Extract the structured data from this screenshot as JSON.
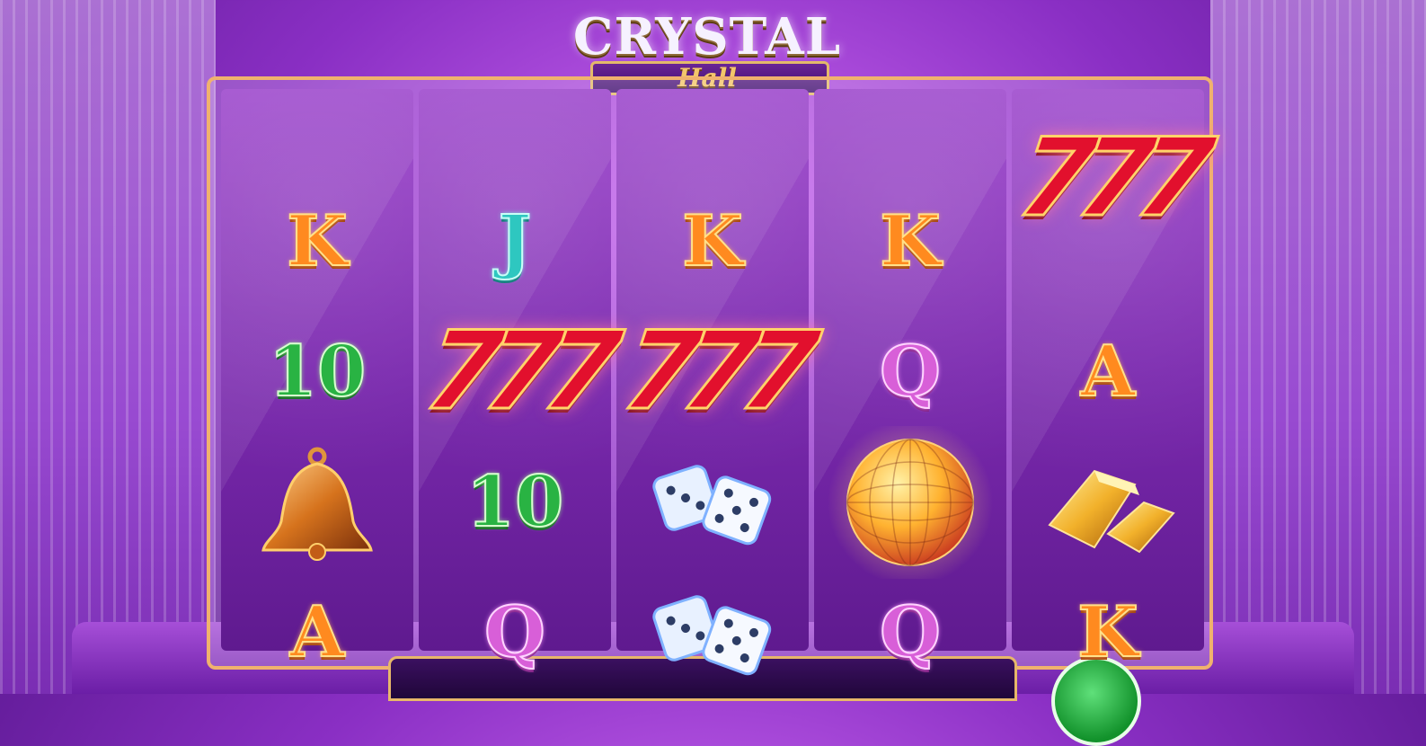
{
  "game": {
    "logo_title": "CRYSTAL",
    "logo_subtitle": "Hall"
  },
  "reels": [
    {
      "symbols": [
        "K",
        "10",
        "bell",
        "A"
      ]
    },
    {
      "symbols": [
        "J",
        "777",
        "10",
        "Q"
      ]
    },
    {
      "symbols": [
        "K",
        "777",
        "dice",
        "dice"
      ]
    },
    {
      "symbols": [
        "K",
        "Q",
        "disco-ball",
        "Q"
      ]
    },
    {
      "symbols": [
        "777",
        "A",
        "gold-bars",
        "K"
      ]
    }
  ],
  "labels": {
    "reel1_row1": "K",
    "reel1_row2": "10",
    "reel1_row4": "A",
    "reel2_row1": "J",
    "reel2_row2": "777",
    "reel2_row3": "10",
    "reel2_row4": "Q",
    "reel3_row1": "K",
    "reel3_row2": "777",
    "reel4_row1": "K",
    "reel4_row2": "Q",
    "reel4_row4": "Q",
    "reel5_row1": "777",
    "reel5_row2": "A",
    "reel5_row4": "K"
  },
  "colors": {
    "frame_gold": "#f0b26e",
    "reel_purple": "#7b2aaf",
    "background": "#8a2fc4",
    "spin_green": "#12922b"
  },
  "icons": [
    "bell-icon",
    "dice-icon",
    "disco-ball-icon",
    "gold-bars-icon",
    "spin-icon"
  ]
}
